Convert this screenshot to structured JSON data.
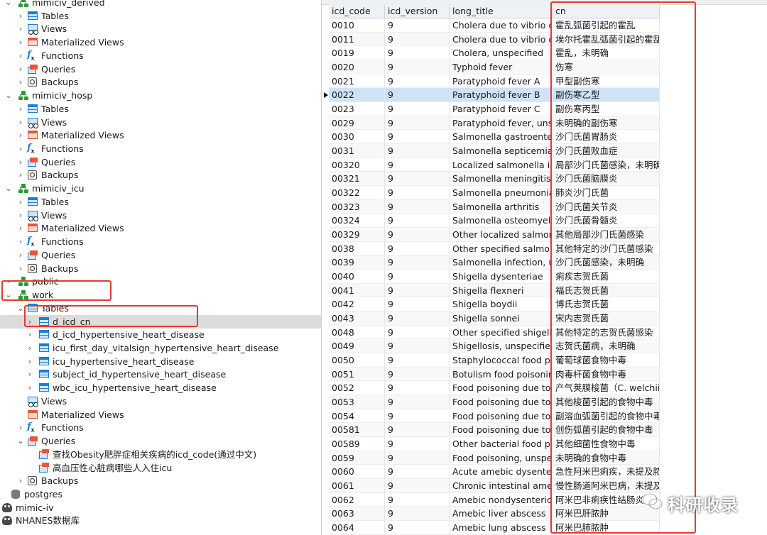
{
  "tree": {
    "items": [
      {
        "label": "mimiciv_derived",
        "icon": "schema-icon",
        "level": 1,
        "expanded": true
      },
      {
        "label": "Tables",
        "icon": "table-icon",
        "level": 2,
        "expanded": false
      },
      {
        "label": "Views",
        "icon": "view-icon",
        "level": 2,
        "expanded": false
      },
      {
        "label": "Materialized Views",
        "icon": "materialized-view-icon",
        "level": 2,
        "expanded": false
      },
      {
        "label": "Functions",
        "icon": "function-icon",
        "level": 2,
        "expanded": false
      },
      {
        "label": "Queries",
        "icon": "query-icon",
        "level": 2,
        "expanded": false
      },
      {
        "label": "Backups",
        "icon": "backup-icon",
        "level": 2,
        "expanded": false
      },
      {
        "label": "mimiciv_hosp",
        "icon": "schema-icon",
        "level": 1,
        "expanded": true
      },
      {
        "label": "Tables",
        "icon": "table-icon",
        "level": 2,
        "expanded": false
      },
      {
        "label": "Views",
        "icon": "view-icon",
        "level": 2,
        "expanded": false
      },
      {
        "label": "Materialized Views",
        "icon": "materialized-view-icon",
        "level": 2,
        "expanded": false
      },
      {
        "label": "Functions",
        "icon": "function-icon",
        "level": 2,
        "expanded": false
      },
      {
        "label": "Queries",
        "icon": "query-icon",
        "level": 2,
        "expanded": false
      },
      {
        "label": "Backups",
        "icon": "backup-icon",
        "level": 2,
        "expanded": false
      },
      {
        "label": "mimiciv_icu",
        "icon": "schema-icon",
        "level": 1,
        "expanded": true
      },
      {
        "label": "Tables",
        "icon": "table-icon",
        "level": 2,
        "expanded": false
      },
      {
        "label": "Views",
        "icon": "view-icon",
        "level": 2,
        "expanded": false
      },
      {
        "label": "Materialized Views",
        "icon": "materialized-view-icon",
        "level": 2,
        "expanded": false
      },
      {
        "label": "Functions",
        "icon": "function-icon",
        "level": 2,
        "expanded": false
      },
      {
        "label": "Queries",
        "icon": "query-icon",
        "level": 2,
        "expanded": false
      },
      {
        "label": "Backups",
        "icon": "backup-icon",
        "level": 2,
        "expanded": false
      },
      {
        "label": "public",
        "icon": "schema-icon",
        "level": 1,
        "expanded": false
      },
      {
        "label": "work",
        "icon": "schema-icon",
        "level": 1,
        "expanded": true
      },
      {
        "label": "Tables",
        "icon": "table-icon",
        "level": 2,
        "expanded": true
      },
      {
        "label": "d_icd_cn",
        "icon": "table-icon",
        "level": 3,
        "selected": true
      },
      {
        "label": "d_icd_hypertensive_heart_disease",
        "icon": "table-icon",
        "level": 3
      },
      {
        "label": "icu_first_day_vitalsign_hypertensive_heart_disease",
        "icon": "table-icon",
        "level": 3
      },
      {
        "label": "icu_hypertensive_heart_disease",
        "icon": "table-icon",
        "level": 3
      },
      {
        "label": "subject_id_hypertensive_heart_disease",
        "icon": "table-icon",
        "level": 3
      },
      {
        "label": "wbc_icu_hypertensive_heart_disease",
        "icon": "table-icon",
        "level": 3
      },
      {
        "label": "Views",
        "icon": "view-icon",
        "level": 2,
        "leaf": true
      },
      {
        "label": "Materialized Views",
        "icon": "materialized-view-icon",
        "level": 2,
        "leaf": true
      },
      {
        "label": "Functions",
        "icon": "function-icon",
        "level": 2,
        "expanded": false
      },
      {
        "label": "Queries",
        "icon": "query-icon",
        "level": 2,
        "expanded": true
      },
      {
        "label": "查找Obesity肥胖症相关疾病的icd_code(通过中文)",
        "icon": "saved-query-icon",
        "level": 3,
        "leaf": true
      },
      {
        "label": "高血压性心脏病哪些人入住icu",
        "icon": "saved-query-icon",
        "level": 3,
        "leaf": true
      },
      {
        "label": "Backups",
        "icon": "backup-icon",
        "level": 2,
        "expanded": false
      },
      {
        "label": "postgres",
        "icon": "database-icon",
        "level": 0,
        "leaf": true
      },
      {
        "label": "mimic-iv",
        "icon": "connection-icon",
        "level": -1,
        "leaf": true
      },
      {
        "label": "NHANES数据库",
        "icon": "connection-icon",
        "level": -1,
        "leaf": true
      }
    ]
  },
  "grid": {
    "columns": [
      "icd_code",
      "icd_version",
      "long_title",
      "cn"
    ],
    "current_row": 5,
    "rows": [
      [
        "0010",
        "9",
        "Cholera due to vibrio cholerae",
        "霍乱弧菌引起的霍乱"
      ],
      [
        "0011",
        "9",
        "Cholera due to vibrio cholerae el tor",
        "埃尔托霍乱弧菌引起的霍乱"
      ],
      [
        "0019",
        "9",
        "Cholera, unspecified",
        "霍乱，未明确"
      ],
      [
        "0020",
        "9",
        "Typhoid fever",
        "伤寒"
      ],
      [
        "0021",
        "9",
        "Paratyphoid fever A",
        "甲型副伤寒"
      ],
      [
        "0022",
        "9",
        "Paratyphoid fever B",
        "副伤寒乙型"
      ],
      [
        "0023",
        "9",
        "Paratyphoid fever C",
        "副伤寒丙型"
      ],
      [
        "0029",
        "9",
        "Paratyphoid fever, unspecified",
        "未明确的副伤寒"
      ],
      [
        "0030",
        "9",
        "Salmonella gastroenteritis",
        "沙门氏菌胃肠炎"
      ],
      [
        "0031",
        "9",
        "Salmonella septicemia",
        "沙门氏菌败血症"
      ],
      [
        "00320",
        "9",
        "Localized salmonella infection",
        "局部沙门氏菌感染，未明确"
      ],
      [
        "00321",
        "9",
        "Salmonella meningitis",
        "沙门氏菌脑膜炎"
      ],
      [
        "00322",
        "9",
        "Salmonella pneumonia",
        "肺炎沙门氏菌"
      ],
      [
        "00323",
        "9",
        "Salmonella arthritis",
        "沙门氏菌关节炎"
      ],
      [
        "00324",
        "9",
        "Salmonella osteomyelitis",
        "沙门氏菌骨髓炎"
      ],
      [
        "00329",
        "9",
        "Other localized salmonella infections",
        "其他局部沙门氏菌感染"
      ],
      [
        "0038",
        "9",
        "Other specified salmonella infections",
        "其他特定的沙门氏菌感染"
      ],
      [
        "0039",
        "9",
        "Salmonella infection, unspecified",
        "沙门氏菌感染，未明确"
      ],
      [
        "0040",
        "9",
        "Shigella dysenteriae",
        "痢疾志贺氏菌"
      ],
      [
        "0041",
        "9",
        "Shigella flexneri",
        "福氏志贺氏菌"
      ],
      [
        "0042",
        "9",
        "Shigella boydii",
        "博氏志贺氏菌"
      ],
      [
        "0043",
        "9",
        "Shigella sonnei",
        "宋内志贺氏菌"
      ],
      [
        "0048",
        "9",
        "Other specified shigella infections",
        "其他特定的志贺氏菌感染"
      ],
      [
        "0049",
        "9",
        "Shigellosis, unspecified",
        "志贺氏菌病，未明确"
      ],
      [
        "0050",
        "9",
        "Staphylococcal food poisoning",
        "葡萄球菌食物中毒"
      ],
      [
        "0051",
        "9",
        "Botulism food poisoning",
        "肉毒杆菌食物中毒"
      ],
      [
        "0052",
        "9",
        "Food poisoning due to Clostridium perfringens",
        "产气荚膜梭菌（C. welchii）"
      ],
      [
        "0053",
        "9",
        "Food poisoning due to other Clostridia",
        "其他梭菌引起的食物中毒"
      ],
      [
        "0054",
        "9",
        "Food poisoning due to Vibrio parahaemolyticus",
        "副溶血弧菌引起的食物中毒"
      ],
      [
        "00581",
        "9",
        "Food poisoning due to Vibrio vulnificus",
        "创伤弧菌引起的食物中毒"
      ],
      [
        "00589",
        "9",
        "Other bacterial food poisoning",
        "其他细菌性食物中毒"
      ],
      [
        "0059",
        "9",
        "Food poisoning, unspecified",
        "未明确的食物中毒"
      ],
      [
        "0060",
        "9",
        "Acute amebic dysentery without mention of abscess",
        "急性阿米巴痢疾，未提及脓肿"
      ],
      [
        "0061",
        "9",
        "Chronic intestinal amebiasis without mention of abscess",
        "慢性肠道阿米巴病，未提及脓肿"
      ],
      [
        "0062",
        "9",
        "Amebic nondysenteric colitis",
        "阿米巴非痢疾性结肠炎"
      ],
      [
        "0063",
        "9",
        "Amebic liver abscess",
        "阿米巴肝脓肿"
      ],
      [
        "0064",
        "9",
        "Amebic lung abscess",
        "阿米巴肺脓肿"
      ]
    ]
  },
  "watermark": {
    "text": "科研收录",
    "icon": "wechat-icon"
  },
  "colors": {
    "highlight": "#e53935",
    "selection": "#dcdcdc",
    "current_row": "#cfe3f7",
    "schema": "#2d9a3a",
    "table": "#1d7fd0"
  }
}
